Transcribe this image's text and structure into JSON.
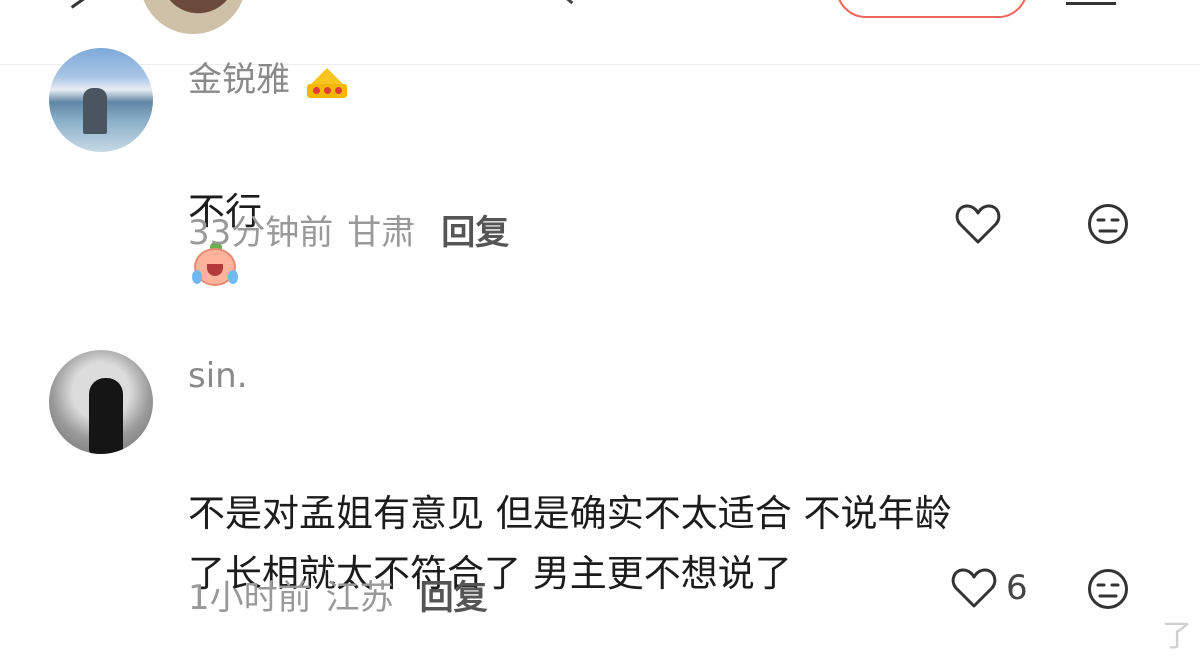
{
  "comments": [
    {
      "username": "金锐雅",
      "badge_icon": "crown-icon",
      "text": "不行",
      "emoji_icon": "crying-face-icon",
      "time": "33分钟前",
      "location": "甘肃",
      "reply_label": "回复",
      "like_count": "",
      "avatar_icon": "glacier-photo-avatar"
    },
    {
      "username": "sin.",
      "text": "不是对孟姐有意见 但是确实不太适合 不说年龄\n了长相就太不符合了 男主更不想说了",
      "time": "1小时前",
      "location": "江苏",
      "reply_label": "回复",
      "like_count": "6",
      "avatar_icon": "beach-silhouette-avatar"
    }
  ],
  "watermark": "了",
  "colors": {
    "accent_follow_border": "#f0665c",
    "meta_gray": "#999999",
    "username_gray": "#8a8a8a"
  }
}
